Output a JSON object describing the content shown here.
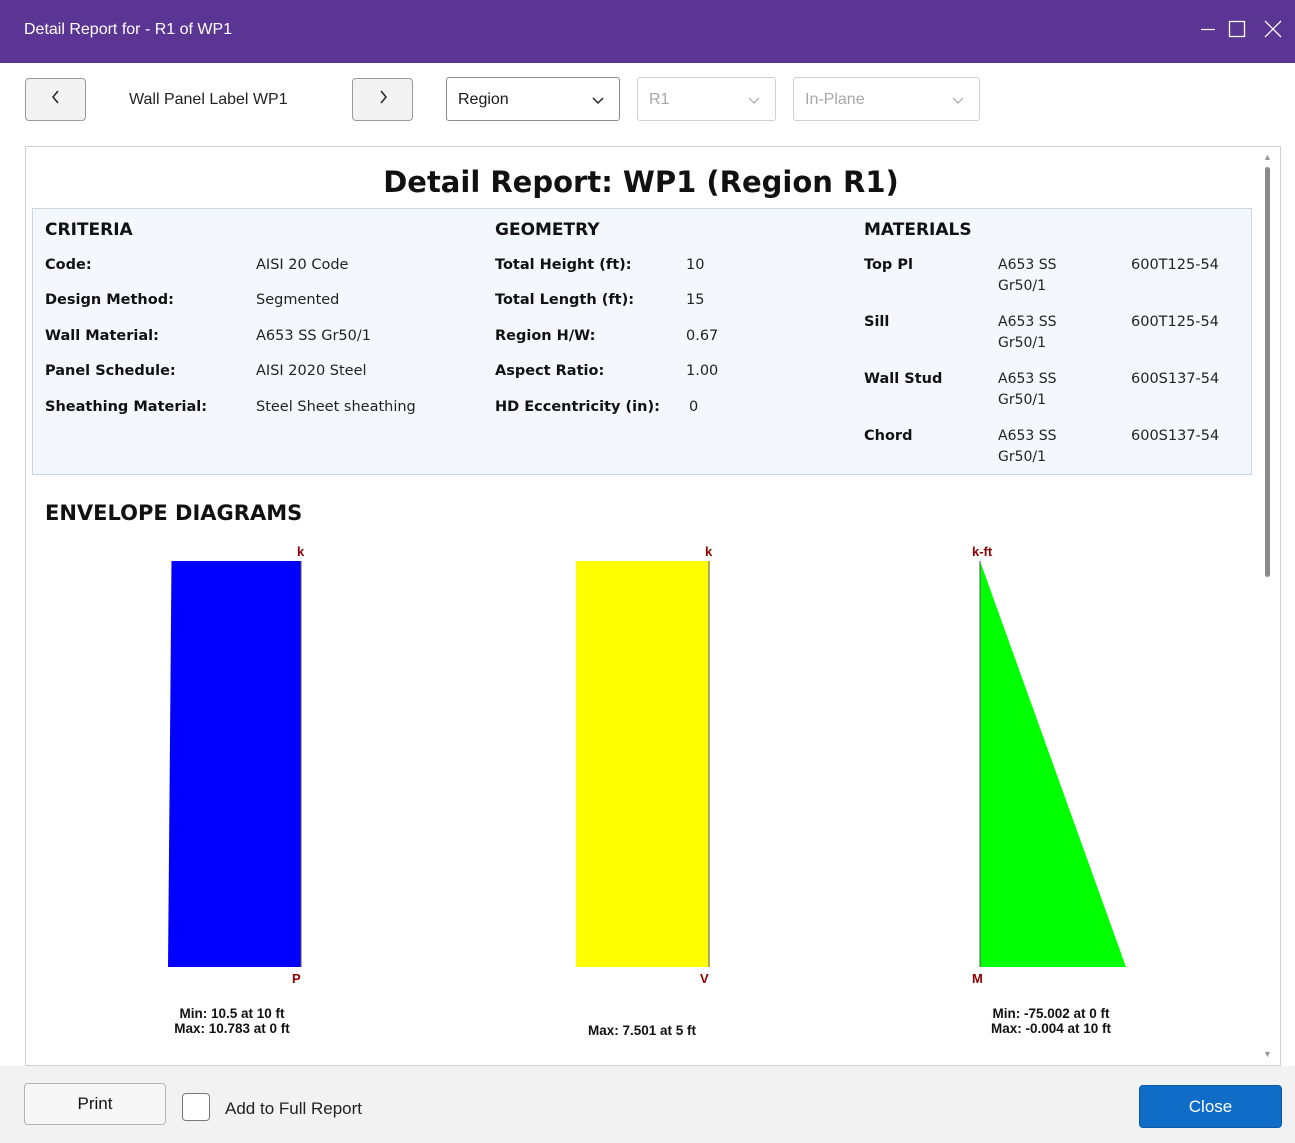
{
  "window": {
    "title": "Detail Report for - R1 of WP1"
  },
  "toolbar": {
    "panel_label": "Wall Panel Label WP1",
    "region_select": "Region",
    "r1_select": "R1",
    "plane_select": "In-Plane"
  },
  "report": {
    "title": "Detail Report: WP1 (Region R1)",
    "criteria": {
      "heading": "CRITERIA",
      "rows": [
        {
          "label": "Code:",
          "value": "AISI 20 Code"
        },
        {
          "label": "Design Method:",
          "value": "Segmented"
        },
        {
          "label": "Wall Material:",
          "value": "A653 SS Gr50/1"
        },
        {
          "label": "Panel Schedule:",
          "value": "AISI 2020 Steel"
        },
        {
          "label": "Sheathing Material:",
          "value": "Steel Sheet sheathing"
        }
      ]
    },
    "geometry": {
      "heading": "GEOMETRY",
      "rows": [
        {
          "label": "Total Height (ft):",
          "value": "10"
        },
        {
          "label": "Total Length (ft):",
          "value": "15"
        },
        {
          "label": "Region H/W:",
          "value": "0.67"
        },
        {
          "label": "Aspect Ratio:",
          "value": "1.00"
        },
        {
          "label": "HD Eccentricity (in):",
          "value": "0"
        }
      ]
    },
    "materials": {
      "heading": "MATERIALS",
      "rows": [
        {
          "label": "Top Pl",
          "material": "A653 SS Gr50/1",
          "section": "600T125-54"
        },
        {
          "label": "Sill",
          "material": "A653 SS Gr50/1",
          "section": "600T125-54"
        },
        {
          "label": "Wall Stud",
          "material": "A653 SS Gr50/1",
          "section": "600S137-54"
        },
        {
          "label": "Chord",
          "material": "A653 SS Gr50/1",
          "section": "600S137-54"
        }
      ]
    },
    "envelope_title": "ENVELOPE DIAGRAMS"
  },
  "chart_data": [
    {
      "type": "area",
      "fill_color": "#0000ff",
      "unit_label": "k",
      "axis_label": "P",
      "x": [
        0,
        5,
        10
      ],
      "y": [
        10.783,
        10.64,
        10.5
      ],
      "caption_lines": [
        "Min: 10.5 at 10 ft",
        "Max: 10.783 at 0 ft"
      ]
    },
    {
      "type": "area",
      "fill_color": "#ffff00",
      "unit_label": "k",
      "axis_label": "V",
      "x": [
        0,
        5,
        10
      ],
      "y": [
        7.501,
        7.501,
        7.501
      ],
      "caption_lines": [
        "Max: 7.501 at 5 ft"
      ]
    },
    {
      "type": "area",
      "fill_color": "#00ff00",
      "unit_label": "k-ft",
      "axis_label": "M",
      "x": [
        0,
        10
      ],
      "y": [
        -75.002,
        -0.004
      ],
      "caption_lines": [
        "Min: -75.002 at 0 ft",
        "Max: -0.004 at 10 ft"
      ]
    }
  ],
  "footer": {
    "print_label": "Print",
    "add_to_report_label": "Add to Full Report",
    "close_label": "Close"
  }
}
